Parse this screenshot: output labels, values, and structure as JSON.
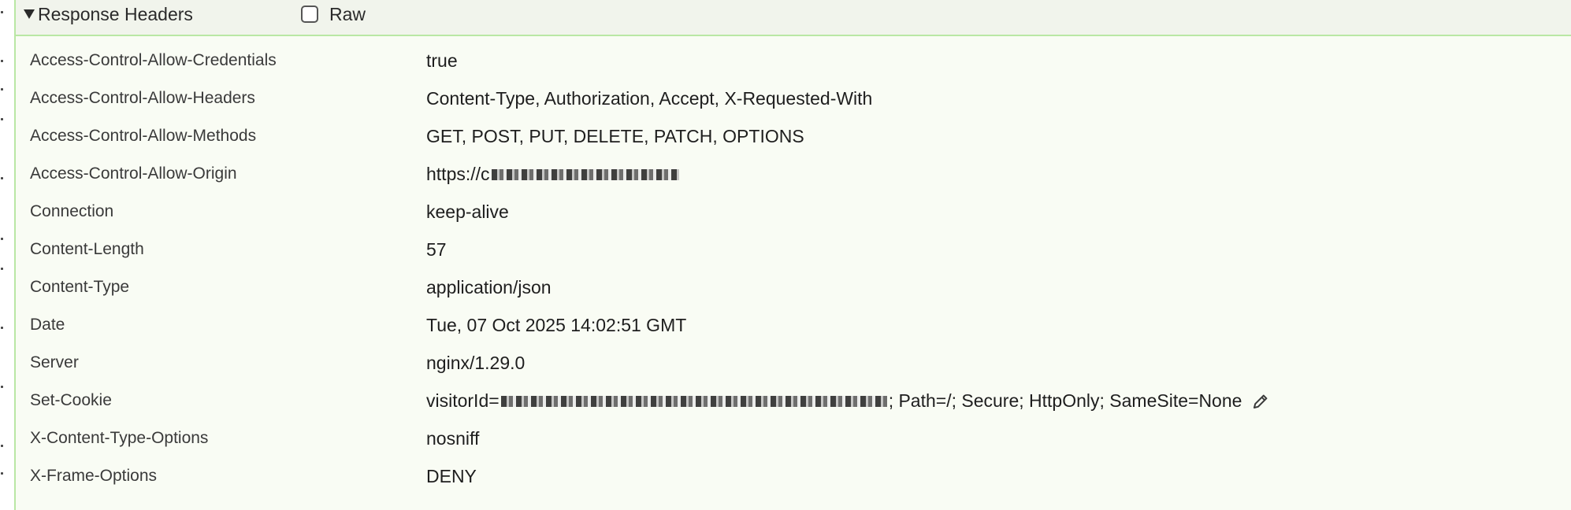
{
  "header": {
    "title": "Response Headers",
    "raw_label": "Raw",
    "raw_checked": false
  },
  "rows": [
    {
      "name": "Access-Control-Allow-Credentials",
      "value": "true"
    },
    {
      "name": "Access-Control-Allow-Headers",
      "value": "Content-Type, Authorization, Accept, X-Requested-With"
    },
    {
      "name": "Access-Control-Allow-Methods",
      "value": "GET, POST, PUT, DELETE, PATCH, OPTIONS"
    },
    {
      "name": "Access-Control-Allow-Origin",
      "value_prefix": "https://c"
    },
    {
      "name": "Connection",
      "value": "keep-alive"
    },
    {
      "name": "Content-Length",
      "value": "57"
    },
    {
      "name": "Content-Type",
      "value": "application/json"
    },
    {
      "name": "Date",
      "value": "Tue, 07 Oct 2025 14:02:51 GMT"
    },
    {
      "name": "Server",
      "value": "nginx/1.29.0"
    },
    {
      "name": "Set-Cookie",
      "value_prefix": "visitorId=",
      "value_suffix": "; Path=/; Secure; HttpOnly; SameSite=None"
    },
    {
      "name": "X-Content-Type-Options",
      "value": "nosniff"
    },
    {
      "name": "X-Frame-Options",
      "value": "DENY"
    }
  ],
  "icons": {
    "disclosure": "triangle-down-icon",
    "edit": "pencil-icon"
  },
  "colors": {
    "accent_border": "#b9e7a4",
    "panel_bg": "#f9fcf4",
    "header_bg": "#f1f4ec"
  }
}
